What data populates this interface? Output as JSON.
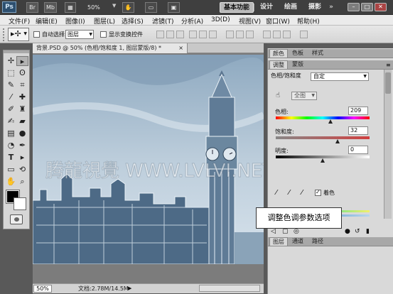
{
  "app": {
    "logo": "Ps",
    "icons": [
      "Br",
      "Mb"
    ],
    "zoom": "50%",
    "workspaces": [
      "基本功能",
      "设计",
      "绘画",
      "摄影"
    ],
    "window_controls": [
      "–",
      "□",
      "✕"
    ]
  },
  "menu": [
    "文件(F)",
    "编辑(E)",
    "图像(I)",
    "图层(L)",
    "选择(S)",
    "滤镜(T)",
    "分析(A)",
    "3D(D)",
    "视图(V)",
    "窗口(W)",
    "帮助(H)"
  ],
  "options_bar": {
    "auto_select_label": "自动选择:",
    "auto_select_value": "图层",
    "show_transform_label": "显示变换控件"
  },
  "document": {
    "tab_title": "背景.PSD @ 50% (色相/饱和度 1, 图层蒙版/8) *",
    "tab_close": "×",
    "watermark": "腾龍視覺 WWW.LVLVI.NET",
    "zoom_field": "50%",
    "doc_info": "文档:2.78M/14.5M"
  },
  "panels": {
    "top_tabs": [
      "颜色",
      "色板",
      "样式"
    ],
    "mid_tabs": [
      "调整",
      "蒙版"
    ],
    "adjustment": {
      "header": "色相/饱和度",
      "preset": "自定",
      "channel": "全图",
      "hue_label": "色相:",
      "hue_value": "209",
      "hue_level": 0.58,
      "saturation_label": "饱和度:",
      "saturation_value": "32",
      "saturation_level": 0.66,
      "lightness_label": "明度:",
      "lightness_value": "0",
      "lightness_level": 0.5,
      "colorize_label": "着色",
      "colorize_checked": true
    },
    "callout": "调整色调参数选项",
    "bottom_tabs": [
      "图层",
      "通道",
      "路径"
    ]
  },
  "colors": {
    "hue_ramp": "linear-gradient(90deg,#f00,#ff0,#0f0,#0ff,#00f,#f0f,#f00)",
    "sat_ramp": "linear-gradient(90deg,#888,#d04040)",
    "light_ramp": "linear-gradient(90deg,#000,#888,#fff)"
  }
}
